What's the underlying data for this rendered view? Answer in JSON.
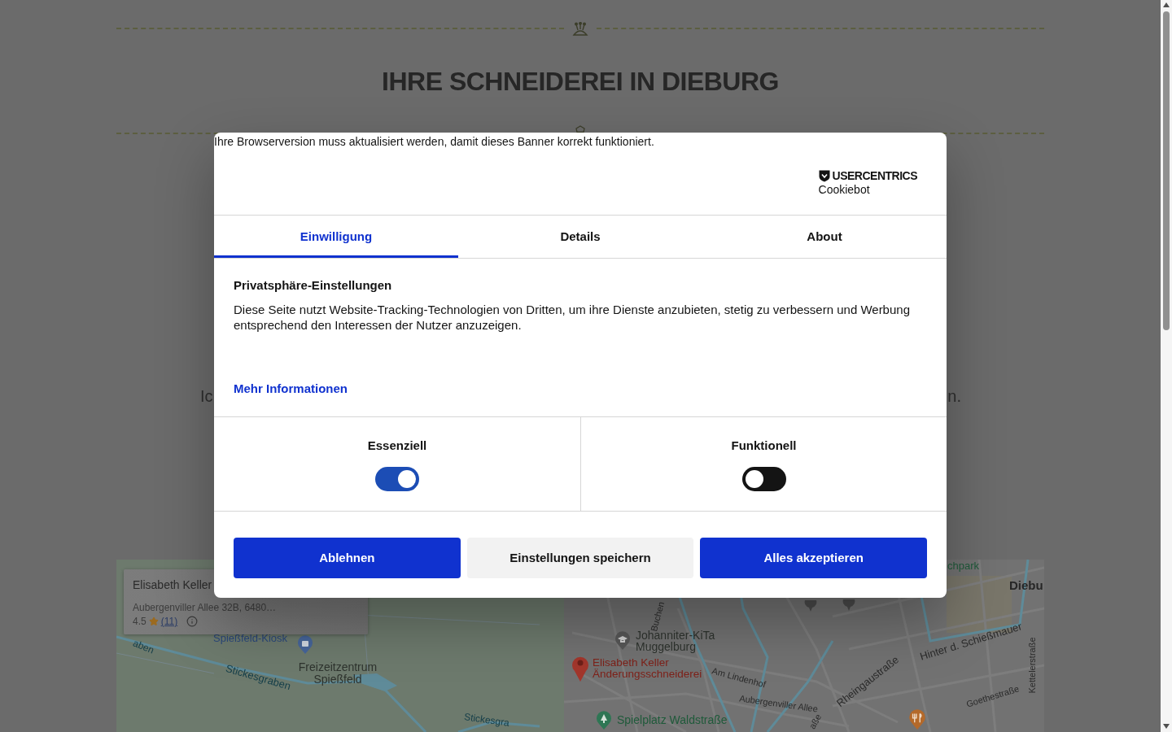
{
  "page": {
    "heading": "IHRE SCHNEIDEREI IN DIEBURG",
    "text_fragments": [
      "Ic",
      "n."
    ]
  },
  "map": {
    "place_card": {
      "name": "Elisabeth Keller",
      "address": "Aubergenviller Allee 32B, 6480…",
      "rating": "4.5",
      "reviews": "(11)"
    },
    "labels": [
      {
        "text": "chpark",
        "kind": "park"
      },
      {
        "text": "Diebu",
        "kind": "town"
      },
      {
        "text": "Spießfeld-Kiosk",
        "kind": "shop"
      },
      {
        "text": "aben",
        "kind": "water"
      },
      {
        "text": "Stickesgraben",
        "kind": "water"
      },
      {
        "text": "Freizeitzentrum Spießfeld",
        "kind": "place"
      },
      {
        "text": "Stickesgra",
        "kind": "water"
      },
      {
        "text": "Buchen",
        "kind": "street"
      },
      {
        "text": "Johanniter-KiTa Muggelburg",
        "kind": "place"
      },
      {
        "text": "Elisabeth Keller Änderungsschneiderei",
        "kind": "business"
      },
      {
        "text": "Am Lindenhof",
        "kind": "street"
      },
      {
        "text": "Aubergenviller Allee",
        "kind": "street"
      },
      {
        "text": "Rheingaustraße",
        "kind": "street"
      },
      {
        "text": "Hinter d. Schießmauer",
        "kind": "street"
      },
      {
        "text": "Kettelerstraße",
        "kind": "street"
      },
      {
        "text": "Goethestraße",
        "kind": "street"
      },
      {
        "text": "Spielplatz Waldstraße",
        "kind": "park"
      },
      {
        "text": "aße",
        "kind": "street"
      }
    ]
  },
  "cookie_banner": {
    "notice": "Ihre Browserversion muss aktualisiert werden, damit dieses Banner korrekt funktioniert.",
    "brand": {
      "name": "USERCENTRICS",
      "product": "Cookiebot"
    },
    "tabs": [
      {
        "label": "Einwilligung",
        "selected": true
      },
      {
        "label": "Details",
        "selected": false
      },
      {
        "label": "About",
        "selected": false
      }
    ],
    "title": "Privatsphäre-Einstellungen",
    "text": "Diese Seite nutzt Website-Tracking-Technologien von Dritten, um ihre Dienste anzubieten, stetig zu verbessern und Werbung entsprechend den Interessen der Nutzer anzuzeigen.",
    "more_link": "Mehr Informationen",
    "categories": [
      {
        "label": "Essenziell",
        "on": true
      },
      {
        "label": "Funktionell",
        "on": false
      }
    ],
    "buttons": [
      {
        "label": "Ablehnen",
        "kind": "primary"
      },
      {
        "label": "Einstellungen speichern",
        "kind": "secondary"
      },
      {
        "label": "Alles akzeptieren",
        "kind": "primary"
      }
    ]
  }
}
